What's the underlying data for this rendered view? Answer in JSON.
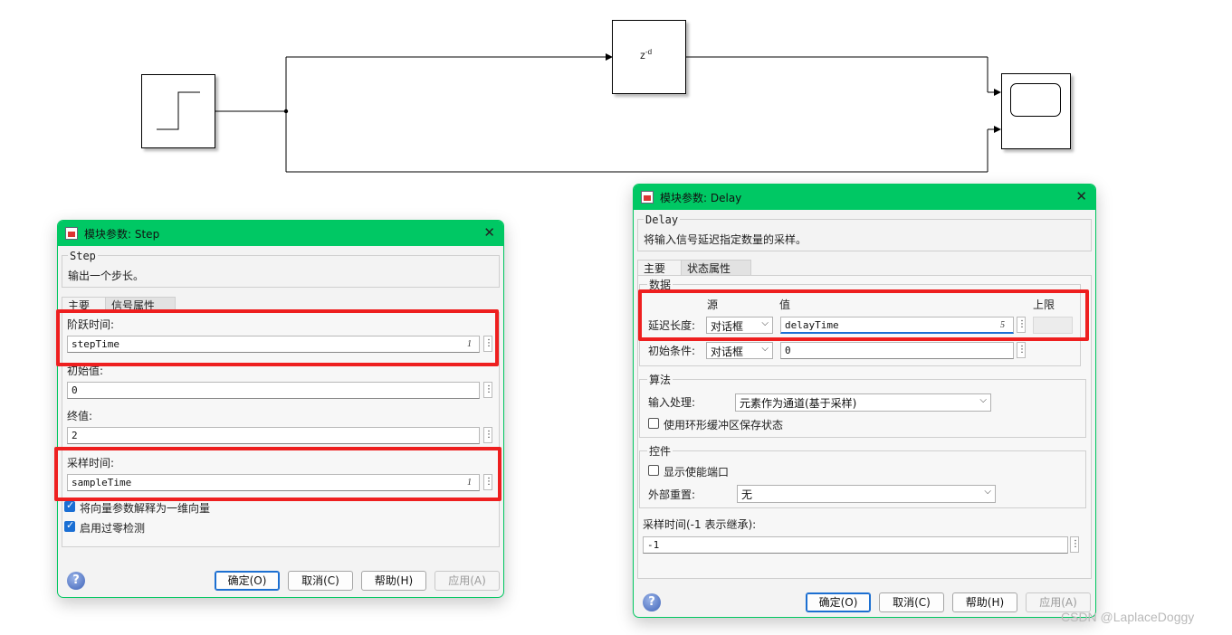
{
  "model": {
    "delay_block_label": "z",
    "delay_block_exponent": "-d"
  },
  "step_dialog": {
    "title": "模块参数: Step",
    "block_name": "Step",
    "description": "输出一个步长。",
    "tabs": [
      "主要",
      "信号属性"
    ],
    "params": [
      {
        "label": "阶跃时间:",
        "value": "stepTime",
        "badge": "1"
      },
      {
        "label": "初始值:",
        "value": "0",
        "badge": ""
      },
      {
        "label": "终值:",
        "value": "2",
        "badge": ""
      },
      {
        "label": "采样时间:",
        "value": "sampleTime",
        "badge": "1"
      }
    ],
    "checkboxes": [
      {
        "label": "将向量参数解释为一维向量",
        "checked": true
      },
      {
        "label": "启用过零检测",
        "checked": true
      }
    ],
    "buttons": {
      "ok": "确定(O)",
      "cancel": "取消(C)",
      "help": "帮助(H)",
      "apply": "应用(A)"
    }
  },
  "delay_dialog": {
    "title": "模块参数: Delay",
    "block_name": "Delay",
    "description": "将输入信号延迟指定数量的采样。",
    "tabs": [
      "主要",
      "状态属性"
    ],
    "data_group": "数据",
    "col_source": "源",
    "col_value": "值",
    "col_upper": "上限",
    "rows": [
      {
        "label": "延迟长度:",
        "source": "对话框",
        "value": "delayTime",
        "badge": "5"
      },
      {
        "label": "初始条件:",
        "source": "对话框",
        "value": "0",
        "badge": ""
      }
    ],
    "algorithm_group": "算法",
    "input_processing_label": "输入处理:",
    "input_processing_value": "元素作为通道(基于采样)",
    "circular_buffer_label": "使用环形缓冲区保存状态",
    "control_group": "控件",
    "enable_port_label": "显示使能端口",
    "external_reset_label": "外部重置:",
    "external_reset_value": "无",
    "sample_time_label": "采样时间(-1 表示继承):",
    "sample_time_value": "-1",
    "buttons": {
      "ok": "确定(O)",
      "cancel": "取消(C)",
      "help": "帮助(H)",
      "apply": "应用(A)"
    }
  },
  "watermark": "CSDN @LaplaceDoggy"
}
